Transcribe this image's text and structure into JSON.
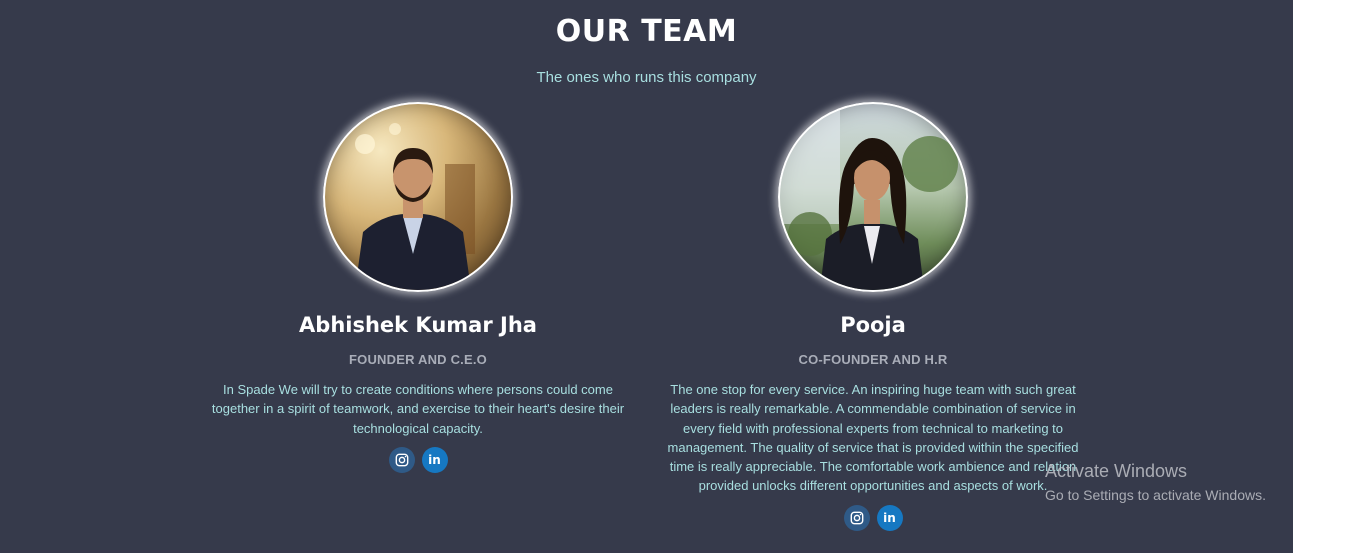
{
  "section": {
    "title": "OUR TEAM",
    "subtitle": "The ones who runs this company"
  },
  "team": [
    {
      "name": "Abhishek Kumar Jha",
      "role": "FOUNDER AND C.E.O",
      "description": "In Spade We will try to create conditions where persons could come together in a spirit of teamwork, and exercise to their heart's desire their technological capacity.",
      "socials": [
        "instagram-icon",
        "linkedin-icon"
      ]
    },
    {
      "name": "Pooja",
      "role": "CO-FOUNDER AND H.R",
      "description": "The one stop for every service. An inspiring huge team with such great leaders is really remarkable. A commendable combination of service in every field with professional experts from technical to marketing to management. The quality of service that is provided within the specified time is really appreciable. The comfortable work ambience and relation provided unlocks different opportunities and aspects of work.",
      "socials": [
        "instagram-icon",
        "linkedin-icon"
      ]
    }
  ],
  "linkedin_glyph": "in",
  "watermark": {
    "line1": "Activate Windows",
    "line2": "Go to Settings to activate Windows."
  },
  "colors": {
    "background": "#363a4b",
    "accent_text": "#a8dfe0",
    "instagram": "#2f5a87",
    "linkedin": "#1678c2"
  }
}
